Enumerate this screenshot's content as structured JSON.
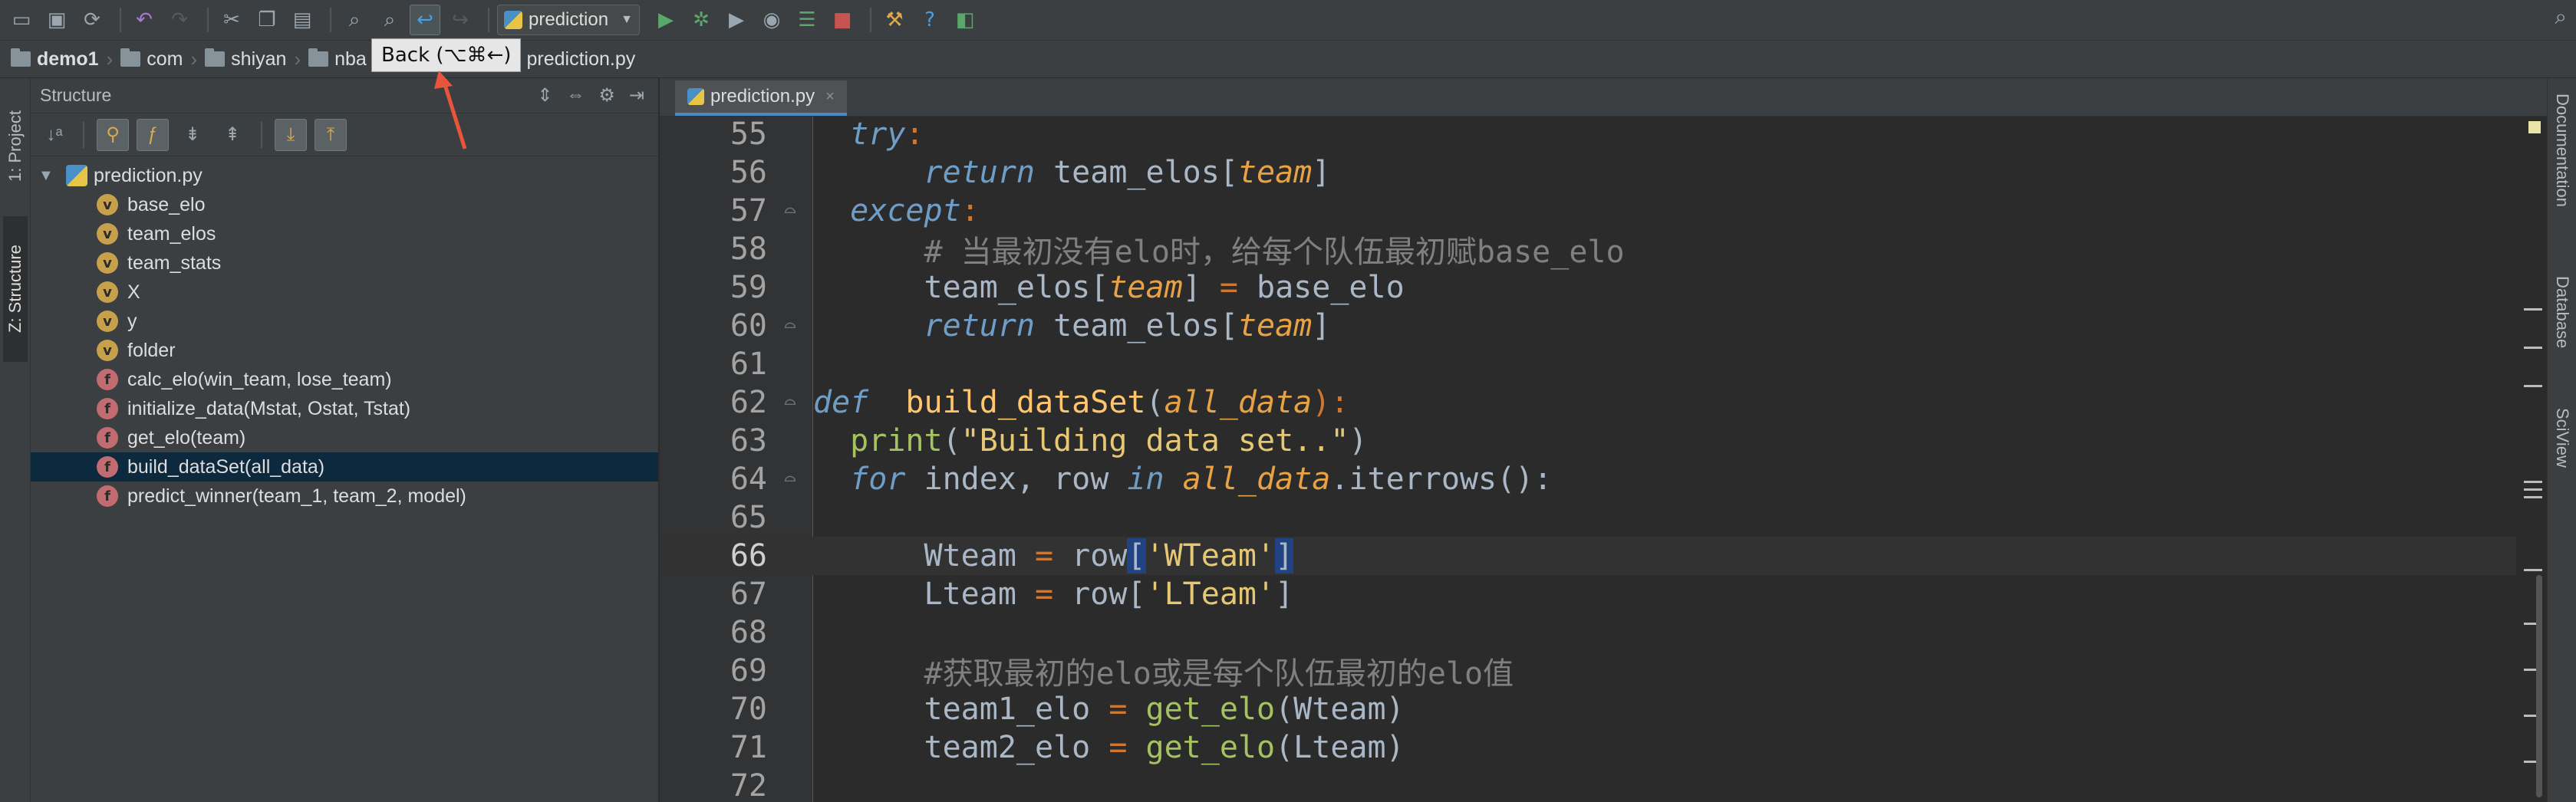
{
  "toolbar": {
    "run_config": "prediction",
    "icons": [
      "open-folder-icon",
      "save-icon",
      "sync-icon",
      "undo-icon",
      "redo-icon",
      "cut-icon",
      "copy-icon",
      "paste-icon",
      "find-icon",
      "replace-icon",
      "back-icon",
      "forward-icon",
      "run-icon",
      "debug-icon",
      "coverage-icon",
      "profile-icon",
      "build-icon",
      "stop-icon",
      "settings-icon",
      "help-icon",
      "sdk-icon",
      "search-icon"
    ]
  },
  "breadcrumb": {
    "items": [
      "demo1",
      "com",
      "shiyan",
      "nba",
      "prediction.py"
    ]
  },
  "tooltip": {
    "text": "Back (⌥⌘←)"
  },
  "left_strip": {
    "project_tab": "1: Project",
    "structure_tab": "Z: Structure"
  },
  "structure": {
    "title": "Structure",
    "root": "prediction.py",
    "items": [
      {
        "kind": "v",
        "label": "base_elo"
      },
      {
        "kind": "v",
        "label": "team_elos"
      },
      {
        "kind": "v",
        "label": "team_stats"
      },
      {
        "kind": "v",
        "label": "X"
      },
      {
        "kind": "v",
        "label": "y"
      },
      {
        "kind": "v",
        "label": "folder"
      },
      {
        "kind": "f",
        "label": "calc_elo(win_team, lose_team)"
      },
      {
        "kind": "f",
        "label": "initialize_data(Mstat, Ostat, Tstat)"
      },
      {
        "kind": "f",
        "label": "get_elo(team)"
      },
      {
        "kind": "f",
        "label": "build_dataSet(all_data)"
      },
      {
        "kind": "f",
        "label": "predict_winner(team_1, team_2, model)"
      }
    ],
    "selected_index": 9
  },
  "editor": {
    "tab_label": "prediction.py",
    "current_line": 66,
    "line_numbers": [
      "55",
      "56",
      "57",
      "58",
      "59",
      "60",
      "61",
      "62",
      "63",
      "64",
      "65",
      "66",
      "67",
      "68",
      "69",
      "70",
      "71",
      "72"
    ],
    "code": {
      "l55_kw": "try",
      "l55_colon": ":",
      "l56_kw": "return",
      "l56_rest": " team_elos[",
      "l56_param": "team",
      "l56_end": "]",
      "l57_kw": "except",
      "l57_colon": ":",
      "l58_cmt": "# 当最初没有elo时，给每个队伍最初赋base_elo",
      "l59_a": "team_elos[",
      "l59_param": "team",
      "l59_b": "] ",
      "l59_eq": "=",
      "l59_c": " base_elo",
      "l60_kw": "return",
      "l60_rest": " team_elos[",
      "l60_param": "team",
      "l60_end": "]",
      "l62_kw": "def",
      "l62_fn": "build_dataSet",
      "l62_open": "(",
      "l62_param": "all_data",
      "l62_close": "):",
      "l63_fn": "print",
      "l63_open": "(",
      "l63_str": "\"Building data set..\"",
      "l63_close": ")",
      "l64_kw": "for",
      "l64_mid": " index, row ",
      "l64_in": "in",
      "l64_param": "all_data",
      "l64_end": ".iterrows():",
      "l66_a": "Wteam ",
      "l66_eq": "=",
      "l66_b": " row",
      "l66_open": "[",
      "l66_str": "'WTeam'",
      "l66_close": "]",
      "l67_a": "Lteam ",
      "l67_eq": "=",
      "l67_b": " row[",
      "l67_str": "'LTeam'",
      "l67_close": "]",
      "l69_cmt": "#获取最初的elo或是每个队伍最初的elo值",
      "l70_a": "team1_elo ",
      "l70_eq": "=",
      "l70_call": "get_elo",
      "l70_b": "(Wteam)",
      "l71_a": "team2_elo ",
      "l71_eq": "=",
      "l71_call": "get_elo",
      "l71_b": "(Lteam)"
    }
  },
  "right_strip": {
    "tabs": [
      "Documentation",
      "Database",
      "SciView"
    ]
  }
}
